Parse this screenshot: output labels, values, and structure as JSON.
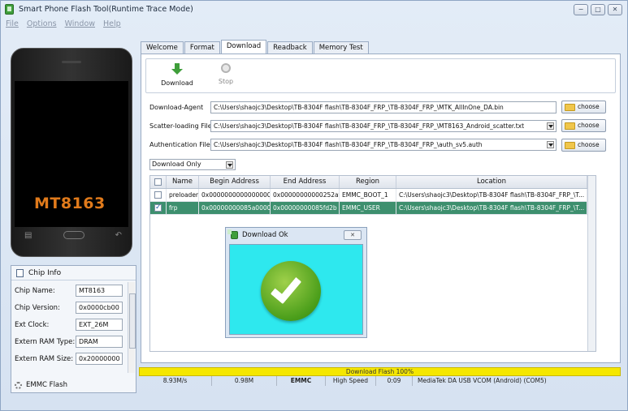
{
  "window": {
    "title": "Smart Phone Flash Tool(Runtime Trace Mode)",
    "controls": [
      "−",
      "□",
      "✕"
    ]
  },
  "menu": [
    "File",
    "Options",
    "Window",
    "Help"
  ],
  "phone": {
    "chip_label": "MT8163"
  },
  "chip_info": {
    "header": "Chip Info",
    "rows": [
      {
        "key": "Chip Name:",
        "value": "MT8163"
      },
      {
        "key": "Chip Version:",
        "value": "0x0000cb00"
      },
      {
        "key": "Ext Clock:",
        "value": "EXT_26M"
      },
      {
        "key": "Extern RAM Type:",
        "value": "DRAM"
      },
      {
        "key": "Extern RAM Size:",
        "value": "0x20000000"
      }
    ],
    "footer": "EMMC Flash"
  },
  "tabs": [
    "Welcome",
    "Format",
    "Download",
    "Readback",
    "Memory Test"
  ],
  "toolbar": {
    "download_label": "Download",
    "stop_label": "Stop"
  },
  "fields": {
    "download_agent": {
      "label": "Download-Agent",
      "value": "C:\\Users\\shaojc3\\Desktop\\TB-8304F flash\\TB-8304F_FRP_\\TB-8304F_FRP_\\MTK_AllInOne_DA.bin"
    },
    "scatter": {
      "label": "Scatter-loading File",
      "value": "C:\\Users\\shaojc3\\Desktop\\TB-8304F flash\\TB-8304F_FRP_\\TB-8304F_FRP_\\MT8163_Android_scatter.txt"
    },
    "auth": {
      "label": "Authentication File",
      "value": "C:\\Users\\shaojc3\\Desktop\\TB-8304F flash\\TB-8304F_FRP_\\TB-8304F_FRP_\\auth_sv5.auth"
    },
    "choose_label": "choose"
  },
  "mode": "Download Only",
  "table": {
    "headers": [
      "Name",
      "Begin Address",
      "End Address",
      "Region",
      "Location"
    ],
    "rows": [
      {
        "name": "preloader",
        "begin": "0x0000000000000000",
        "end": "0x00000000000252af",
        "region": "EMMC_BOOT_1",
        "location": "C:\\Users\\shaojc3\\Desktop\\TB-8304F flash\\TB-8304F_FRP_\\T..."
      },
      {
        "name": "frp",
        "begin": "0x00000000085a0000",
        "end": "0x00000000085fd2b",
        "region": "EMMC_USER",
        "location": "C:\\Users\\shaojc3\\Desktop\\TB-8304F flash\\TB-8304F_FRP_\\T..."
      }
    ]
  },
  "dialog": {
    "title": "Download Ok"
  },
  "status": {
    "progress_text": "Download Flash 100%",
    "progress": 1.0,
    "speed": "8.93M/s",
    "size": "0.98M",
    "storage": "EMMC",
    "usb_speed": "High Speed",
    "time": "0:09",
    "port": "MediaTek DA USB VCOM (Android) (COM5)"
  }
}
